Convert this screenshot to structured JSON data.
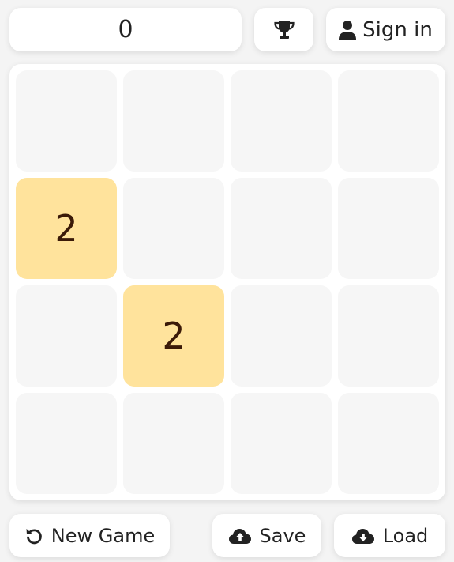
{
  "score": {
    "value": "0"
  },
  "header": {
    "trophy_icon": "trophy-icon",
    "signin_label": "Sign in",
    "user_icon": "user-icon"
  },
  "board": {
    "size": 4,
    "empty_color": "#f6f6f6",
    "tile_colors": {
      "2": "#ffe39c"
    },
    "rows": [
      [
        "",
        "",
        "",
        ""
      ],
      [
        "2",
        "",
        "",
        ""
      ],
      [
        "",
        "2",
        "",
        ""
      ],
      [
        "",
        "",
        "",
        ""
      ]
    ]
  },
  "footer": {
    "new_game_label": "New Game",
    "save_label": "Save",
    "load_label": "Load",
    "new_game_icon": "undo-icon",
    "save_icon": "cloud-upload-icon",
    "load_icon": "cloud-download-icon"
  }
}
